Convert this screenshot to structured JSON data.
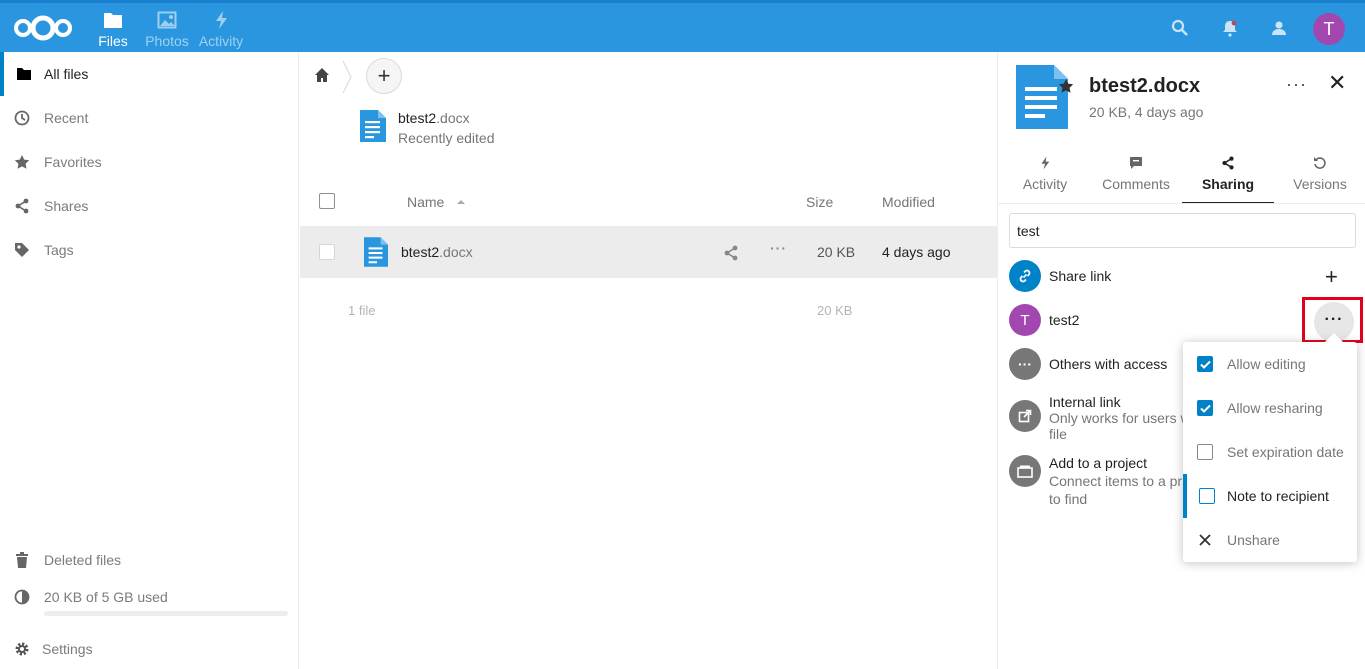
{
  "header": {
    "apps": [
      {
        "label": "Files",
        "icon": "folder-icon",
        "active": true
      },
      {
        "label": "Photos",
        "icon": "image-icon",
        "active": false
      },
      {
        "label": "Activity",
        "icon": "lightning-icon",
        "active": false
      }
    ],
    "avatar_letter": "T",
    "colors": {
      "header_bg": "#2a96df",
      "avatar": "#a347b0"
    }
  },
  "sidebar": {
    "items": [
      {
        "label": "All files",
        "icon": "folder-icon",
        "active": true
      },
      {
        "label": "Recent",
        "icon": "clock-icon"
      },
      {
        "label": "Favorites",
        "icon": "star-icon"
      },
      {
        "label": "Shares",
        "icon": "share-icon"
      },
      {
        "label": "Tags",
        "icon": "tag-icon"
      }
    ],
    "deleted_label": "Deleted files",
    "quota_label": "20 KB of 5 GB used",
    "quota_fraction": 4e-06,
    "settings_label": "Settings"
  },
  "main": {
    "recent": {
      "name": "btest2",
      "ext": ".docx",
      "subtitle": "Recently edited"
    },
    "columns": {
      "name": "Name",
      "size": "Size",
      "modified": "Modified"
    },
    "files": [
      {
        "name": "btest2",
        "ext": ".docx",
        "size": "20 KB",
        "modified": "4 days ago"
      }
    ],
    "summary": {
      "count": "1 file",
      "size": "20 KB"
    }
  },
  "details": {
    "title": "btest2.docx",
    "subtitle": "20 KB, 4 days ago",
    "tabs": [
      {
        "label": "Activity",
        "icon": "lightning-icon"
      },
      {
        "label": "Comments",
        "icon": "comment-icon"
      },
      {
        "label": "Sharing",
        "icon": "share-icon",
        "active": true
      },
      {
        "label": "Versions",
        "icon": "history-icon"
      }
    ],
    "search_value": "test",
    "share_link_label": "Share link",
    "sharee": {
      "name": "test2",
      "letter": "T"
    },
    "others_label": "Others with access",
    "internal_link": {
      "title": "Internal link",
      "line1": "Only works for users w",
      "line2": "file"
    },
    "project": {
      "title": "Add to a project",
      "line1": "Connect items to a pr",
      "line2": "to find"
    },
    "menu": [
      {
        "label": "Allow editing",
        "checked": true
      },
      {
        "label": "Allow resharing",
        "checked": true
      },
      {
        "label": "Set expiration date",
        "checked": false
      },
      {
        "label": "Note to recipient",
        "checked": false,
        "focused": true
      },
      {
        "label": "Unshare",
        "icon": "close-icon"
      }
    ]
  }
}
